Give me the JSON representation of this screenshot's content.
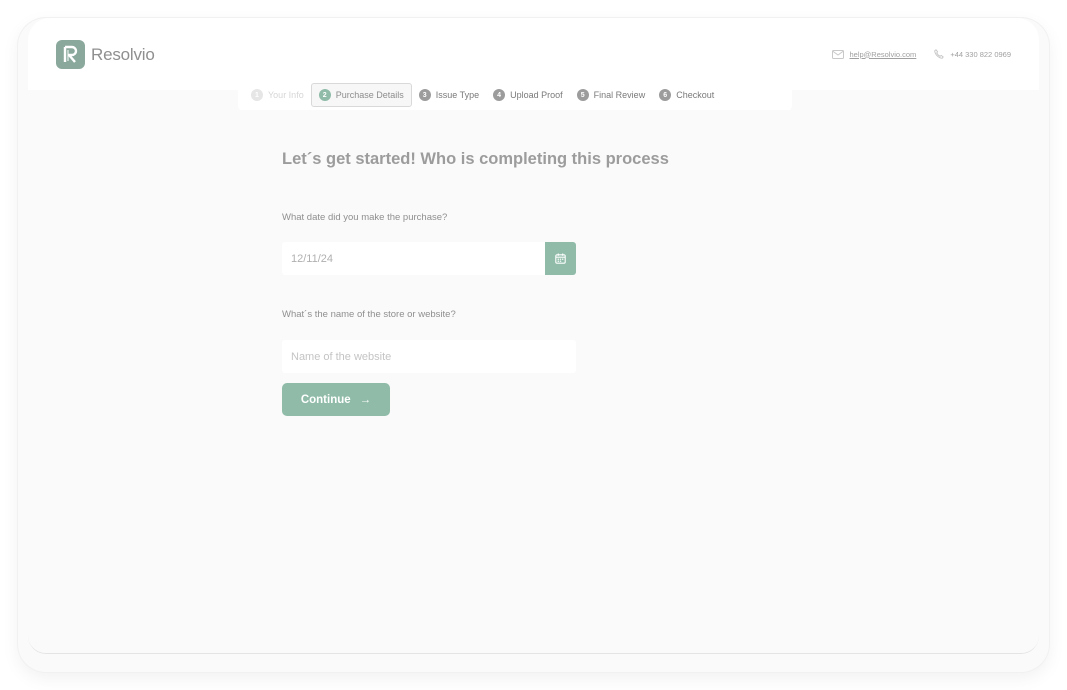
{
  "brand": {
    "name": "Resolvio",
    "accent": "#8fbba8"
  },
  "contact": {
    "email": "help@Resolvio.com",
    "phone": "+44 330 822 0969"
  },
  "steps": [
    {
      "num": "1",
      "label": "Your Info",
      "state": "done"
    },
    {
      "num": "2",
      "label": "Purchase Details",
      "state": "active"
    },
    {
      "num": "3",
      "label": "Issue Type",
      "state": "pending"
    },
    {
      "num": "4",
      "label": "Upload Proof",
      "state": "pending"
    },
    {
      "num": "5",
      "label": "Final Review",
      "state": "pending"
    },
    {
      "num": "6",
      "label": "Checkout",
      "state": "pending"
    }
  ],
  "form": {
    "title": "Let´s get started! Who is completing this process",
    "date_label": "What date did you make the purchase?",
    "date_value": "12/11/24",
    "store_label": "What´s the name of the store or website?",
    "store_value": "",
    "store_placeholder": "Name of the website",
    "continue_label": "Continue",
    "continue_arrow": "→"
  }
}
